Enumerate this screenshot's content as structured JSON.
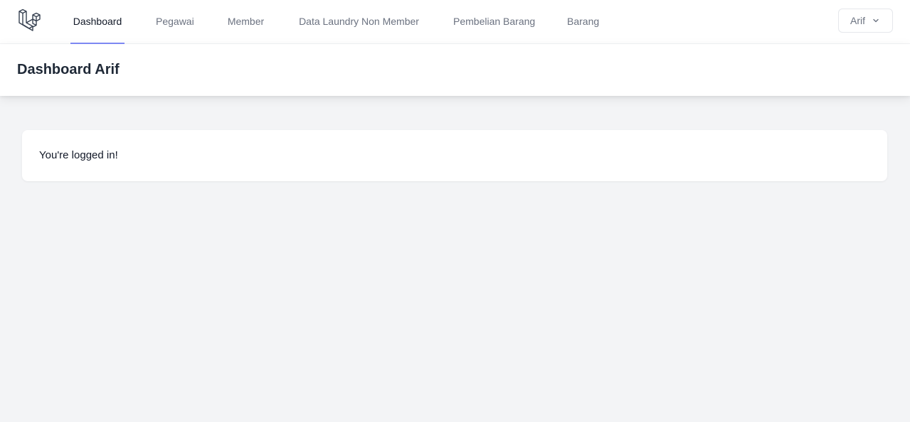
{
  "nav": {
    "logo_icon": "laravel-logo-icon",
    "links": [
      {
        "label": "Dashboard",
        "active": true
      },
      {
        "label": "Pegawai",
        "active": false
      },
      {
        "label": "Member",
        "active": false
      },
      {
        "label": "Data Laundry Non Member",
        "active": false
      },
      {
        "label": "Pembelian Barang",
        "active": false
      },
      {
        "label": "Barang",
        "active": false
      }
    ],
    "user": {
      "name": "Arif",
      "icon": "chevron-down-icon"
    }
  },
  "header": {
    "title": "Dashboard Arif"
  },
  "main": {
    "message": "You're logged in!"
  },
  "colors": {
    "background": "#f3f4f6",
    "active_underline": "#818cf8",
    "inactive_link": "#6b7280",
    "active_link": "#111827"
  }
}
